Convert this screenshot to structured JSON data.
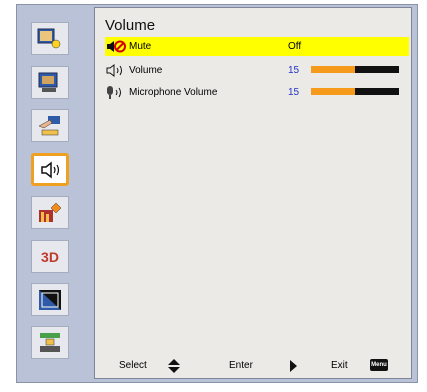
{
  "sidebar": {
    "items": [
      {
        "icon": "display-brightness-icon"
      },
      {
        "icon": "projector-screen-icon"
      },
      {
        "icon": "setup-hand-icon"
      },
      {
        "icon": "speaker-volume-icon",
        "active": true
      },
      {
        "icon": "options-info-icon"
      },
      {
        "icon": "3d-icon",
        "text": "3D"
      },
      {
        "icon": "lan-network-icon"
      },
      {
        "icon": "network-plug-icon"
      }
    ]
  },
  "panel": {
    "title": "Volume",
    "rows": [
      {
        "label": "Mute",
        "value": "Off",
        "icon": "mute-icon"
      },
      {
        "label": "Volume",
        "value": "15",
        "level": 15,
        "max": 30,
        "icon": "speaker-icon"
      },
      {
        "label": "Microphone Volume",
        "value": "15",
        "level": 15,
        "max": 30,
        "icon": "microphone-icon"
      }
    ]
  },
  "footer": {
    "select_label": "Select",
    "enter_label": "Enter",
    "exit_label": "Exit",
    "menu_key": "Menu"
  },
  "colors": {
    "highlight": "#ffff00",
    "active_border": "#f0a020",
    "bar_fill": "#f59a1a",
    "value_blue": "#2233c4"
  }
}
